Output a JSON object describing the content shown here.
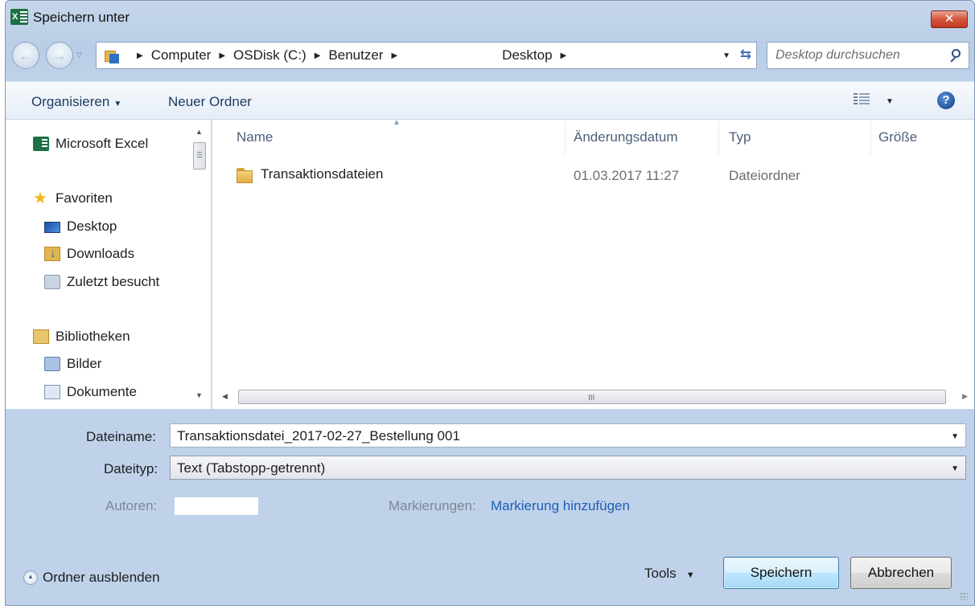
{
  "window": {
    "title": "Speichern unter",
    "close_label": "✕"
  },
  "address": {
    "crumbs": [
      "Computer",
      "OSDisk (C:)",
      "Benutzer",
      "",
      "Desktop"
    ]
  },
  "search": {
    "placeholder": "Desktop durchsuchen"
  },
  "toolbar": {
    "organize_label": "Organisieren",
    "new_folder_label": "Neuer Ordner"
  },
  "sidebar": {
    "items": [
      {
        "label": "Microsoft Excel",
        "icon": "excel-icon"
      },
      {
        "label": "Favoriten",
        "icon": "star-icon"
      },
      {
        "label": "Desktop",
        "icon": "desktop-icon"
      },
      {
        "label": "Downloads",
        "icon": "downloads-icon"
      },
      {
        "label": "Zuletzt besucht",
        "icon": "recent-places-icon"
      },
      {
        "label": "Bibliotheken",
        "icon": "libraries-icon"
      },
      {
        "label": "Bilder",
        "icon": "pictures-icon"
      },
      {
        "label": "Dokumente",
        "icon": "documents-icon"
      }
    ]
  },
  "filelist": {
    "columns": [
      "Name",
      "Änderungsdatum",
      "Typ",
      "Größe"
    ],
    "rows": [
      {
        "name": "Transaktionsdateien",
        "date": "01.03.2017 11:27",
        "type": "Dateiordner",
        "size": ""
      }
    ]
  },
  "form": {
    "filename_label": "Dateiname:",
    "filename_value": "Transaktionsdatei_2017-02-27_Bestellung 001",
    "filetype_label": "Dateityp:",
    "filetype_value": "Text (Tabstopp-getrennt)",
    "authors_label": "Autoren:",
    "tags_label": "Markierungen:",
    "tags_link": "Markierung hinzufügen"
  },
  "footer": {
    "hide_folders_label": "Ordner ausblenden",
    "tools_label": "Tools",
    "save_label": "Speichern",
    "cancel_label": "Abbrechen"
  },
  "colors": {
    "accent": "#1e5fb4",
    "window_frame": "#bfd2ea",
    "close_button": "#c2391f",
    "excel_green": "#1e7145"
  }
}
